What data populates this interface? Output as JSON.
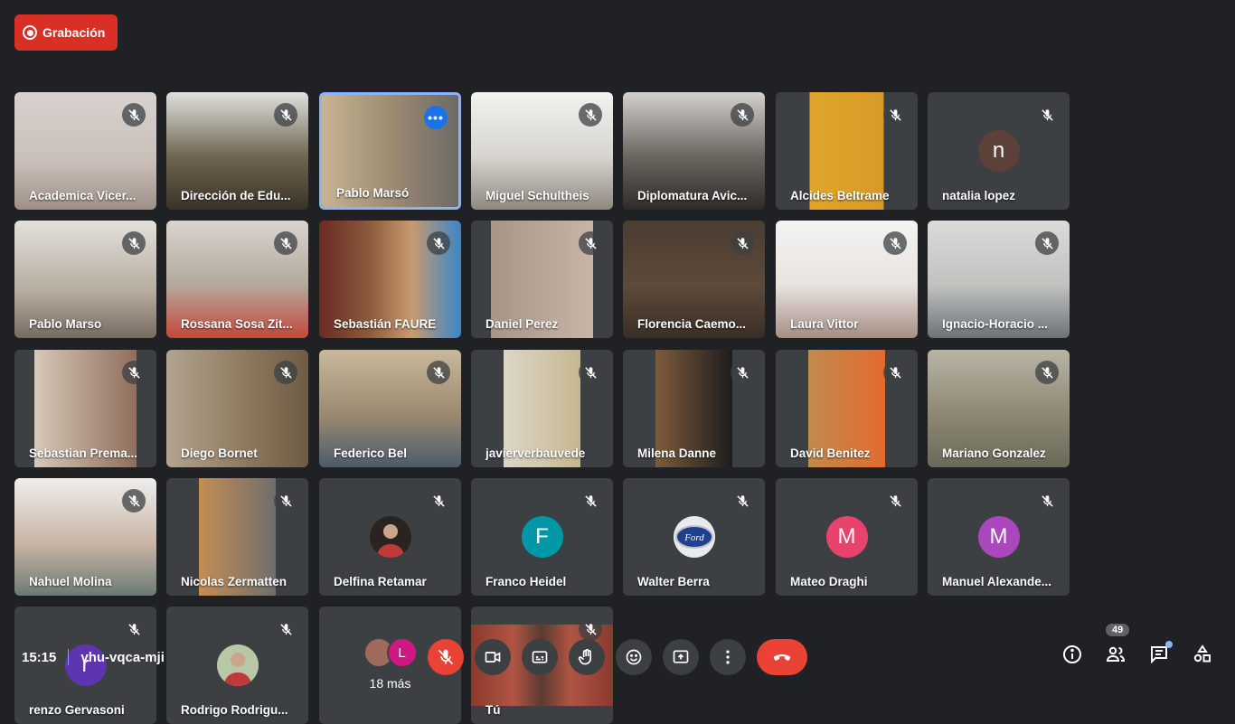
{
  "recording": {
    "label": "Grabación",
    "color": "#d93025"
  },
  "tiles": [
    {
      "name": "Academica Vicer...",
      "bg": "linear-gradient(180deg,#d8d2cf 0%,#c9bfb8 60%,#9d8f86 100%)",
      "active": false
    },
    {
      "name": "Dirección de Edu...",
      "bg": "linear-gradient(180deg,#e0e2df 0%,#6f6550 55%,#3a3228 100%)",
      "active": false
    },
    {
      "name": "Pablo Marsó",
      "bg": "linear-gradient(90deg,#c7b493 0%,#9e8c73 50%,#6c6a66 100%)",
      "active": true
    },
    {
      "name": "Miguel Schultheis",
      "bg": "linear-gradient(180deg,#f2f2ef 0%,#d6d4cf 55%,#8f887f 100%)",
      "active": false
    },
    {
      "name": "Diplomatura Avic...",
      "bg": "linear-gradient(180deg,#d4d1cd 0%,#6b6560 55%,#2e2b2a 100%)",
      "active": false
    },
    {
      "name": "Alcides Beltrame",
      "bg": "linear-gradient(90deg,#3c4043 0%,#3c4043 24%,#e0a52a 24%,#d79a28 76%,#3c4043 76%)",
      "active": false
    },
    {
      "name": "natalia lopez",
      "avatar_letter": "n",
      "avatar_color": "#5d4037",
      "active": false
    },
    {
      "name": "Pablo Marso",
      "bg": "linear-gradient(180deg,#e4e1db 0%,#b6ac9f 60%,#756b60 100%)",
      "active": false
    },
    {
      "name": "Rossana Sosa Zit...",
      "bg": "linear-gradient(180deg,#dad4cd 0%,#b3a89b 55%,#c4473c 100%)",
      "active": false
    },
    {
      "name": "Sebastián FAURE",
      "bg": "linear-gradient(90deg,#6a2b24 0%,#8a5a3c 35%,#c99a6f 65%,#3a86c8 100%)",
      "active": false
    },
    {
      "name": "Daniel Perez",
      "bg": "linear-gradient(90deg,#3c4043 0%,#3c4043 14%,#a99587 14%,#c8b5a7 86%,#3c4043 86%)",
      "active": false
    },
    {
      "name": "Florencia Caemo...",
      "bg": "linear-gradient(180deg,#4a3d32 0%,#5d4a3a 55%,#3a2e25 100%)",
      "active": false
    },
    {
      "name": "Laura Vittor",
      "bg": "linear-gradient(180deg,#f4f4f3 0%,#e8e3df 55%,#a58e84 100%)",
      "active": false
    },
    {
      "name": "Ignacio-Horacio ...",
      "bg": "linear-gradient(180deg,#d9dcd8 0%,#bfc2bd 55%,#6c7279 100%)",
      "active": false
    },
    {
      "name": "Sebastian Prema...",
      "bg": "linear-gradient(90deg,#3c4043 0%,#3c4043 14%,#d7c9b8 14%,#8f6e5c 86%,#3c4043 86%)",
      "active": false
    },
    {
      "name": "Diego Bornet",
      "bg": "linear-gradient(90deg,#b2a48f 0%,#8e7a5f 55%,#6e5b43 100%)",
      "active": false
    },
    {
      "name": "Federico Bel",
      "bg": "linear-gradient(180deg,#c9b99b 0%,#9b8970 55%,#4c5b6c 100%)",
      "active": false
    },
    {
      "name": "javierverbauvede",
      "bg": "linear-gradient(90deg,#3c4043 0%,#3c4043 23%,#dcd6c7 23%,#c5b78f 77%,#3c4043 77%)",
      "active": false
    },
    {
      "name": "Milena Danne",
      "bg": "linear-gradient(90deg,#3c4043 0%,#3c4043 23%,#7d5b3b 23%,#1d1d1e 77%,#3c4043 77%)",
      "active": false
    },
    {
      "name": "David Benitez",
      "bg": "linear-gradient(90deg,#3c4043 0%,#3c4043 23%,#c08b4c 23%,#e36a2f 77%,#3c4043 77%)",
      "active": false
    },
    {
      "name": "Mariano Gonzalez",
      "bg": "linear-gradient(180deg,#b9b4a5 0%,#8d8773 55%,#6a6a5a 100%)",
      "active": false
    },
    {
      "name": "Nahuel Molina",
      "bg": "linear-gradient(180deg,#eeeeec 0%,#c9b6a6 55%,#6b7a73 100%)",
      "active": false
    },
    {
      "name": "Nicolas Zermatten",
      "bg": "linear-gradient(90deg,#3c4043 0%,#3c4043 23%,#c48d53 23%,#6f6d6d 77%,#3c4043 77%)",
      "active": false
    },
    {
      "name": "Delfina Retamar",
      "avatar_photo": true,
      "avatar_color": "#2a2420",
      "active": false
    },
    {
      "name": "Franco Heidel",
      "avatar_letter": "F",
      "avatar_color": "#0097a7",
      "active": false
    },
    {
      "name": "Walter Berra",
      "avatar_logo": true,
      "avatar_color": "#e8eaed",
      "active": false
    },
    {
      "name": "Mateo Draghi",
      "avatar_letter": "M",
      "avatar_color": "#e8436d",
      "active": false
    },
    {
      "name": "Manuel Alexande...",
      "avatar_letter": "M",
      "avatar_color": "#ab47bc",
      "active": false
    },
    {
      "name": "renzo Gervasoni",
      "avatar_letter": "r",
      "avatar_color": "#5e35b1",
      "active": false
    },
    {
      "name": "Rodrigo Rodrigu...",
      "avatar_photo": true,
      "avatar_color": "#b8c7a6",
      "active": false
    }
  ],
  "more": {
    "label": "18 más",
    "letter": "L"
  },
  "self": {
    "name": "Tú",
    "bg": "linear-gradient(90deg,#8a3a2e 0%,#b05543 30%,#5a3a32 50%,#b05543 70%,#8a3a2e 100%)"
  },
  "meeting": {
    "time": "15:15",
    "code": "vhu-vqca-mji"
  },
  "controls": [
    {
      "name": "mic-toggle",
      "icon": "mic-off-icon"
    },
    {
      "name": "camera-toggle",
      "icon": "video-icon"
    },
    {
      "name": "captions-toggle",
      "icon": "captions-icon"
    },
    {
      "name": "raise-hand",
      "icon": "hand-icon"
    },
    {
      "name": "reactions",
      "icon": "emoji-icon"
    },
    {
      "name": "present-now",
      "icon": "present-icon"
    },
    {
      "name": "more-options",
      "icon": "more-vert-icon"
    },
    {
      "name": "leave-call",
      "icon": "call-end-icon"
    }
  ],
  "people_count": "49"
}
